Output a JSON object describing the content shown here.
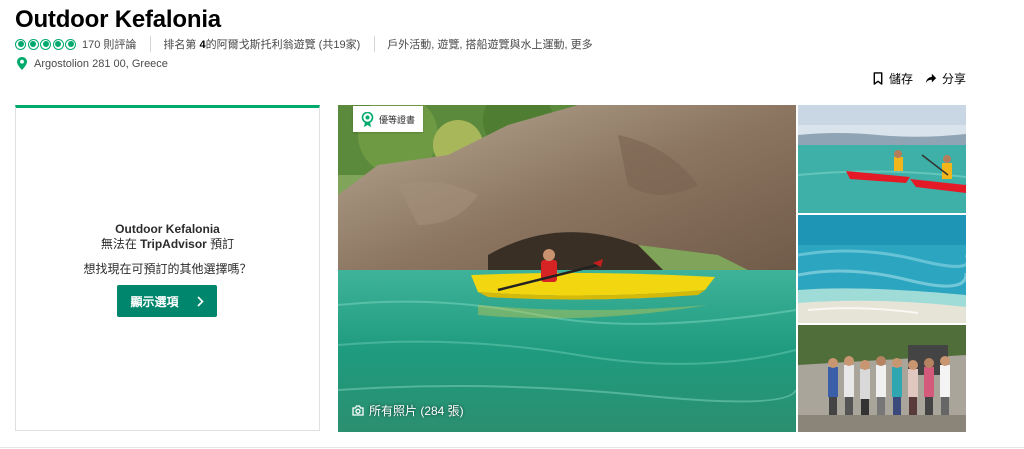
{
  "header": {
    "title": "Outdoor Kefalonia",
    "rating_bubbles": 5,
    "review_count": "170 則評論",
    "rank_prefix": "排名第 ",
    "rank_number": "4",
    "rank_suffix": "的阿爾戈斯托利翁遊覽 (共19家)",
    "categories": "戶外活動, 遊覽, 搭船遊覽與水上運動, 更多",
    "address": "Argostolion 281 00, Greece"
  },
  "actions": {
    "save_label": "儲存",
    "share_label": "分享"
  },
  "booking_card": {
    "name": "Outdoor Kefalonia",
    "unavailable_prefix": "無法在 ",
    "unavailable_brand": "TripAdvisor",
    "unavailable_suffix": " 預訂",
    "question": "想找現在可預訂的其他選擇嗎？",
    "button_label": "顯示選項"
  },
  "photos": {
    "badge_label": "優等證書",
    "all_photos_label": "所有照片 (284 張)"
  },
  "colors": {
    "brand_green": "#00aa6c",
    "button_green": "#00866c",
    "text_dark": "#000000",
    "text_muted": "#4a4a4a"
  },
  "icons": {
    "bubble": "rating-bubble-icon",
    "pin": "map-pin-icon",
    "save": "bookmark-icon",
    "share": "share-arrow-icon",
    "chevron": "chevron-right-icon",
    "badge": "certificate-icon",
    "camera": "camera-icon"
  }
}
